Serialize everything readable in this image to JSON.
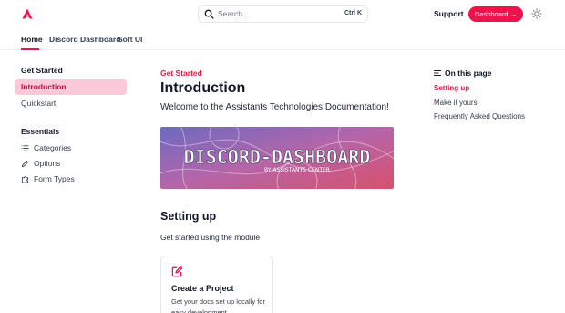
{
  "header": {
    "search_placeholder": "Search...",
    "search_shortcut": "Ctrl K",
    "support_label": "Support",
    "dashboard_label": "Dashboard →",
    "brand_color": "#f0124a"
  },
  "tabs": [
    {
      "label": "Home",
      "active": true
    },
    {
      "label": "Discord Dashboard",
      "active": false
    },
    {
      "label": "Soft UI",
      "active": false
    }
  ],
  "sidebar": {
    "groups": [
      {
        "heading": "Get Started",
        "items": [
          {
            "label": "Introduction",
            "active": true
          },
          {
            "label": "Quickstart",
            "active": false
          }
        ]
      },
      {
        "heading": "Essentials",
        "items": [
          {
            "label": "Categories",
            "icon": "list-icon"
          },
          {
            "label": "Options",
            "icon": "pencil-icon"
          },
          {
            "label": "Form Types",
            "icon": "puzzle-icon"
          }
        ]
      }
    ]
  },
  "main": {
    "eyebrow": "Get Started",
    "title": "Introduction",
    "lead": "Welcome to the Assistants Technologies Documentation!",
    "banner": {
      "title": "DISCORD-DASHBOARD",
      "subtitle": "BY ASSISTANTS CENTER"
    },
    "section_title": "Setting up",
    "section_text": "Get started using the module",
    "card": {
      "icon": "edit-icon",
      "title": "Create a Project",
      "description": "Get your docs set up locally for easy development"
    }
  },
  "toc": {
    "title": "On this page",
    "items": [
      {
        "label": "Setting up",
        "active": true
      },
      {
        "label": "Make it yours",
        "active": false
      },
      {
        "label": "Frequently Asked Questions",
        "active": false
      }
    ]
  }
}
